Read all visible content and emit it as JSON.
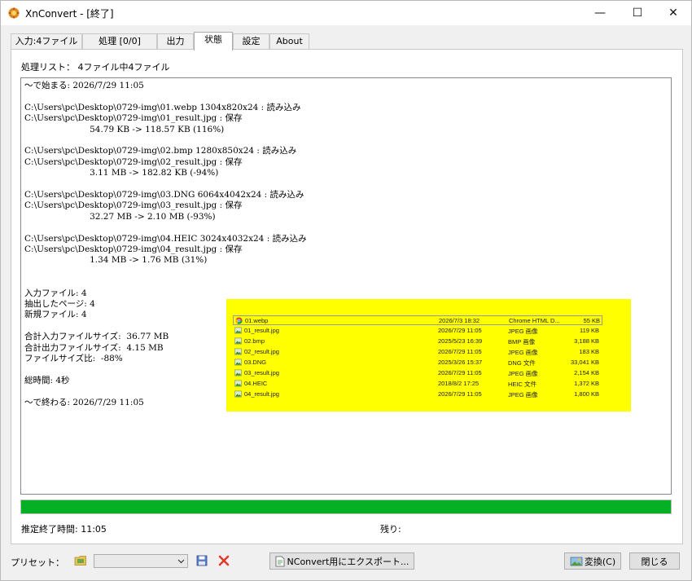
{
  "window": {
    "title": "XnConvert - [終了]",
    "controls": {
      "minimize": "—",
      "maximize": "☐",
      "close": "✕"
    }
  },
  "tabs": [
    {
      "label": "入力:4ファイル"
    },
    {
      "label": "処理 [0/0]"
    },
    {
      "label": "出力"
    },
    {
      "label": "状態",
      "active": true
    },
    {
      "label": "設定"
    },
    {
      "label": "About"
    }
  ],
  "status": {
    "list_header": "処理リスト： 4ファイル中4ファイル",
    "log": [
      "～で始まる: 2026/7/29 11:05",
      "",
      "C:\\Users\\pc\\Desktop\\0729-img\\01.webp 1304x820x24 : 読み込み",
      "C:\\Users\\pc\\Desktop\\0729-img\\01_result.jpg : 保存",
      "                        54.79 KB -> 118.57 KB (116%)",
      "",
      "C:\\Users\\pc\\Desktop\\0729-img\\02.bmp 1280x850x24 : 読み込み",
      "C:\\Users\\pc\\Desktop\\0729-img\\02_result.jpg : 保存",
      "                        3.11 MB -> 182.82 KB (-94%)",
      "",
      "C:\\Users\\pc\\Desktop\\0729-img\\03.DNG 6064x4042x24 : 読み込み",
      "C:\\Users\\pc\\Desktop\\0729-img\\03_result.jpg : 保存",
      "                        32.27 MB -> 2.10 MB (-93%)",
      "",
      "C:\\Users\\pc\\Desktop\\0729-img\\04.HEIC 3024x4032x24 : 読み込み",
      "C:\\Users\\pc\\Desktop\\0729-img\\04_result.jpg : 保存",
      "                        1.34 MB -> 1.76 MB (31%)",
      "",
      "",
      "入力ファイル: 4",
      "抽出したページ: 4",
      "新規ファイル: 4",
      "",
      "合計入力ファイルサイズ:  36.77 MB",
      "合計出力ファイルサイズ:  4.15 MB",
      "ファイルサイズ比:  -88%",
      "",
      "総時間: 4秒",
      "",
      "～で終わる: 2026/7/29 11:05"
    ],
    "progress_fraction": 1.0,
    "progress_color": "#06b025",
    "estimated_end": "推定終了時間: 11:05",
    "remaining": "残り:"
  },
  "explorer": {
    "highlight_color": "#ffff00",
    "rows": [
      {
        "name": "01.webp",
        "date": "2026/7/3 18:32",
        "type": "Chrome HTML D...",
        "size": "55 KB",
        "icon": "chrome-icon",
        "selected": true
      },
      {
        "name": "01_result.jpg",
        "date": "2026/7/29 11:05",
        "type": "JPEG 画像",
        "size": "119 KB",
        "icon": "image-file-icon"
      },
      {
        "name": "02.bmp",
        "date": "2025/5/23 16:39",
        "type": "BMP 画像",
        "size": "3,188 KB",
        "icon": "image-file-icon"
      },
      {
        "name": "02_result.jpg",
        "date": "2026/7/29 11:05",
        "type": "JPEG 画像",
        "size": "183 KB",
        "icon": "image-file-icon"
      },
      {
        "name": "03.DNG",
        "date": "2025/3/26 15:37",
        "type": "DNG 文件",
        "size": "33,041 KB",
        "icon": "image-file-icon"
      },
      {
        "name": "03_result.jpg",
        "date": "2026/7/29 11:05",
        "type": "JPEG 画像",
        "size": "2,154 KB",
        "icon": "image-file-icon"
      },
      {
        "name": "04.HEIC",
        "date": "2018/8/2 17:25",
        "type": "HEIC 文件",
        "size": "1,372 KB",
        "icon": "image-file-icon"
      },
      {
        "name": "04_result.jpg",
        "date": "2026/7/29 11:05",
        "type": "JPEG 画像",
        "size": "1,800 KB",
        "icon": "image-file-icon"
      }
    ]
  },
  "bottom": {
    "preset_label": "プリセット：",
    "preset_value": "",
    "export_label": "NConvert用にエクスポート...",
    "convert_label": "変換(C)",
    "close_label": "閉じる"
  }
}
